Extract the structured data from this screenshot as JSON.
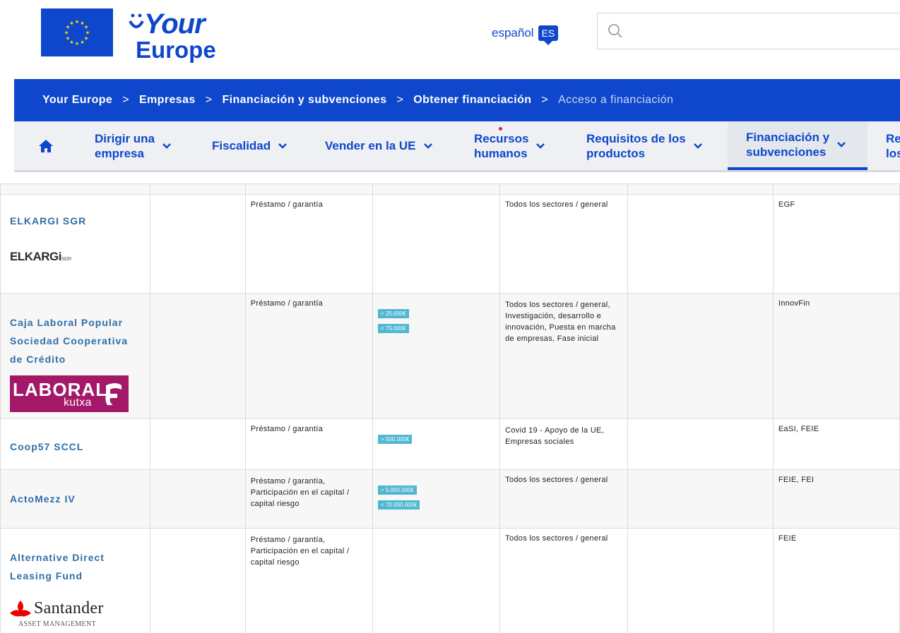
{
  "header": {
    "logo_your": "Your",
    "logo_europe": "Europe",
    "language_label": "español",
    "language_code": "ES",
    "search_placeholder": ""
  },
  "breadcrumb": {
    "items": [
      "Your Europe",
      "Empresas",
      "Financiación y subvenciones",
      "Obtener financiación"
    ],
    "current": "Acceso a financiación",
    "separator": ">"
  },
  "nav": {
    "items": [
      {
        "line1": "Dirigir una",
        "line2": "empresa"
      },
      {
        "line1": "Fiscalidad",
        "line2": ""
      },
      {
        "line1": "Vender en la UE",
        "line2": ""
      },
      {
        "line1": "Recursos",
        "line2": "humanos"
      },
      {
        "line1": "Requisitos de los",
        "line2": "productos"
      },
      {
        "line1": "Financiación y",
        "line2": "subvenciones"
      },
      {
        "line1": "Re",
        "line2": "los"
      }
    ]
  },
  "table": {
    "rows": [
      {
        "name": [
          "ELKARGI SGR"
        ],
        "logo_text": "ELKARGi",
        "logo_suffix": "SGR",
        "type": "Préstamo / garantía",
        "badges": [],
        "sectors": "Todos los sectores / general",
        "program": "EGF"
      },
      {
        "name": [
          "Caja Laboral Popular",
          "Sociedad Cooperativa",
          "de Crédito"
        ],
        "logo_text": "LABORAL",
        "logo_suffix": "kutxa",
        "type": "Préstamo / garantía",
        "badges": [
          "> 25.000€",
          "< 75.000€"
        ],
        "sectors": "Todos los sectores / general, Investigación, desarrollo e innovación, Puesta en marcha de empresas, Fase inicial",
        "program": "InnovFin"
      },
      {
        "name": [
          "Coop57 SCCL"
        ],
        "type": "Préstamo / garantía",
        "badges": [
          "> 500.000€"
        ],
        "sectors": "Covid 19 - Apoyo de la UE, Empresas sociales",
        "program": "EaSI, FEIE"
      },
      {
        "name": [
          "ActoMezz IV"
        ],
        "type": "Préstamo / garantía, Participación en el capital / capital riesgo",
        "badges": [
          "> 5.000.000€",
          "< 70.000.000€"
        ],
        "sectors": "Todos los sectores / general",
        "program": "FEIE, FEI"
      },
      {
        "name": [
          "Alternative Direct",
          "Leasing Fund"
        ],
        "logo_text": "Santander",
        "logo_suffix": "ASSET MANAGEMENT",
        "type": "Préstamo / garantía, Participación en el capital / capital riesgo",
        "badges": [],
        "sectors": "Todos los sectores / general",
        "program": "FEIE"
      }
    ]
  },
  "colors": {
    "brand_blue": "#0e47cb",
    "link_blue": "#2e6fa8",
    "badge_cyan": "#4fb7d1",
    "laboral_magenta": "#a31868",
    "santander_red": "#ec0000"
  }
}
